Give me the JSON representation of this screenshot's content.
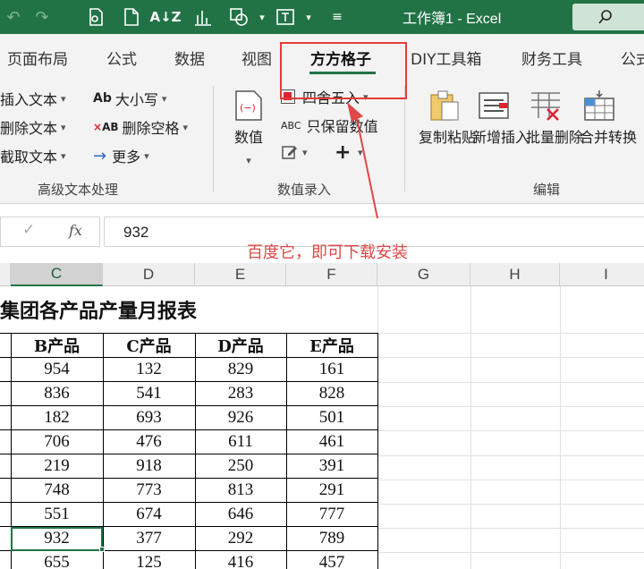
{
  "title_bar": {
    "workbook_title": "工作簿1 - Excel"
  },
  "tabs": [
    "页面布局",
    "公式",
    "数据",
    "视图",
    "方方格子",
    "DIY工具箱",
    "财务工具",
    "公式"
  ],
  "active_tab": "方方格子",
  "ribbon": {
    "text_group": {
      "items": [
        "插入文本",
        "删除文本",
        "截取文本",
        "大小写",
        "删除空格",
        "更多"
      ],
      "label": "高级文本处理"
    },
    "value_group": {
      "big_button": "数值",
      "items": [
        "四舍五入",
        "只保留数值"
      ],
      "label": "数值录入"
    },
    "edit_group": {
      "buttons": [
        "复制粘贴",
        "新增插入",
        "批量删除",
        "合并转换"
      ],
      "label": "编辑"
    }
  },
  "formula_bar": {
    "fx": "fx",
    "value": "932"
  },
  "annotation": "百度它，即可下载安装",
  "columns": [
    "C",
    "D",
    "E",
    "F",
    "G",
    "H",
    "I"
  ],
  "selected_column": "C",
  "sheet": {
    "title": "集团各产品产量月报表",
    "headers": [
      "B产品",
      "C产品",
      "D产品",
      "E产品"
    ],
    "rows": [
      [
        "954",
        "132",
        "829",
        "161"
      ],
      [
        "836",
        "541",
        "283",
        "828"
      ],
      [
        "182",
        "693",
        "926",
        "501"
      ],
      [
        "706",
        "476",
        "611",
        "461"
      ],
      [
        "219",
        "918",
        "250",
        "391"
      ],
      [
        "748",
        "773",
        "813",
        "291"
      ],
      [
        "551",
        "674",
        "646",
        "777"
      ],
      [
        "932",
        "377",
        "292",
        "789"
      ],
      [
        "655",
        "125",
        "416",
        "457"
      ]
    ]
  },
  "colors": {
    "excel_green": "#217346",
    "annotation_red": "#e04848"
  }
}
